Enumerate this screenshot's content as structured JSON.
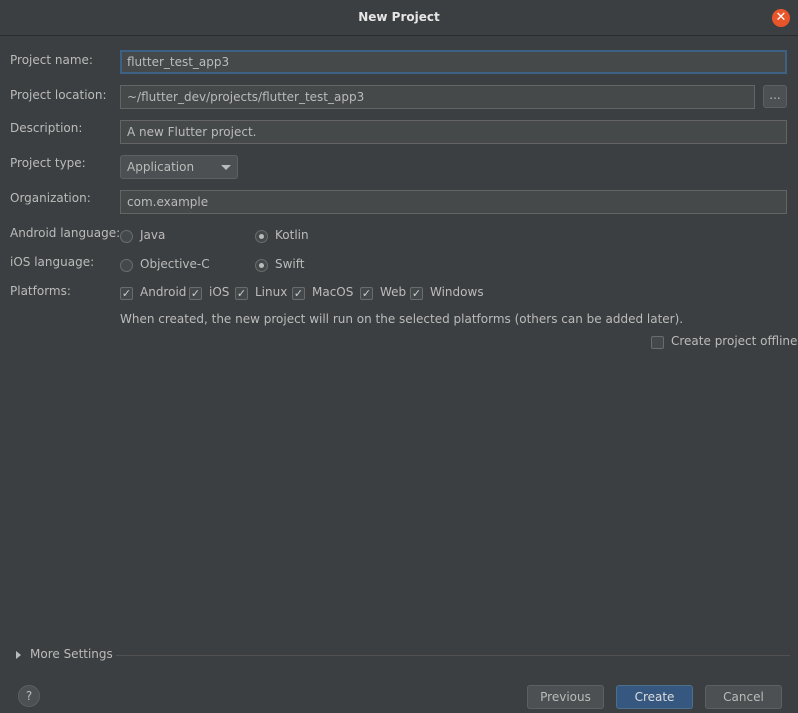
{
  "window": {
    "title": "New Project",
    "close_symbol": "✕"
  },
  "form": {
    "project_name": {
      "label": "Project name:",
      "value": "flutter_test_app3"
    },
    "project_location": {
      "label": "Project location:",
      "value": "~/flutter_dev/projects/flutter_test_app3",
      "browse_label": "..."
    },
    "description": {
      "label": "Description:",
      "value": "A new Flutter project."
    },
    "project_type": {
      "label": "Project type:",
      "value": "Application"
    },
    "organization": {
      "label": "Organization:",
      "value": "com.example"
    },
    "android_language": {
      "label": "Android language:",
      "options": [
        {
          "label": "Java",
          "checked": false
        },
        {
          "label": "Kotlin",
          "checked": true
        }
      ]
    },
    "ios_language": {
      "label": "iOS language:",
      "options": [
        {
          "label": "Objective-C",
          "checked": false
        },
        {
          "label": "Swift",
          "checked": true
        }
      ]
    },
    "platforms": {
      "label": "Platforms:",
      "items": [
        {
          "label": "Android",
          "checked": true
        },
        {
          "label": "iOS",
          "checked": true
        },
        {
          "label": "Linux",
          "checked": true
        },
        {
          "label": "MacOS",
          "checked": true
        },
        {
          "label": "Web",
          "checked": true
        },
        {
          "label": "Windows",
          "checked": true
        }
      ],
      "hint": "When created, the new project will run on the selected platforms (others can be added later)."
    },
    "offline": {
      "label": "Create project offline",
      "checked": false
    }
  },
  "more_settings": {
    "label": "More Settings"
  },
  "footer": {
    "help_label": "?",
    "previous_label": "Previous",
    "create_label": "Create",
    "cancel_label": "Cancel"
  },
  "colors": {
    "background": "#3c3f41",
    "primary_button": "#365880",
    "close_button": "#e9552b"
  }
}
